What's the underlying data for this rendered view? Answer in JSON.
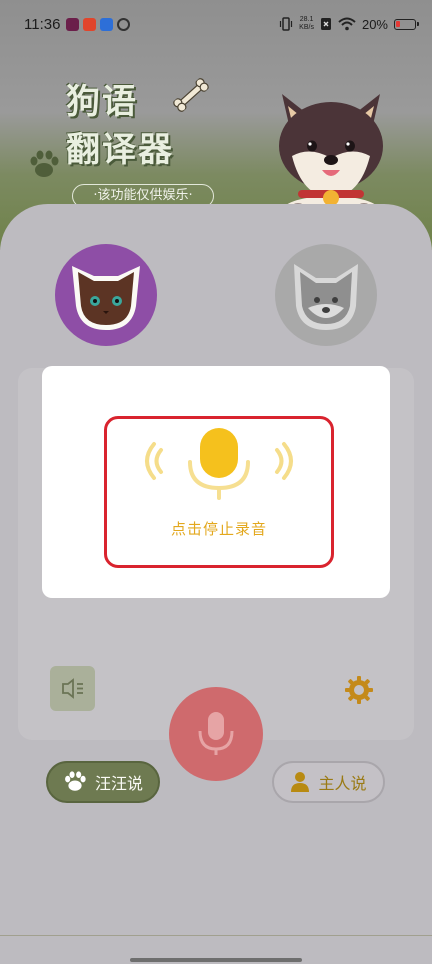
{
  "status_bar": {
    "time": "11:36",
    "net_speed_value": "28.1",
    "net_speed_unit": "KB/s",
    "battery": "20%"
  },
  "header": {
    "title_line1": "狗语",
    "title_line2": "翻译器",
    "subtitle": "·该功能仅供娱乐·"
  },
  "recording_popup": {
    "label": "点击停止录音"
  },
  "controls": {
    "dog_say_label": "汪汪说",
    "master_say_label": "主人说"
  },
  "colors": {
    "accent_green": "#6e7a51",
    "mic_yellow": "#f5c11d",
    "highlight_red": "#d9232e"
  }
}
